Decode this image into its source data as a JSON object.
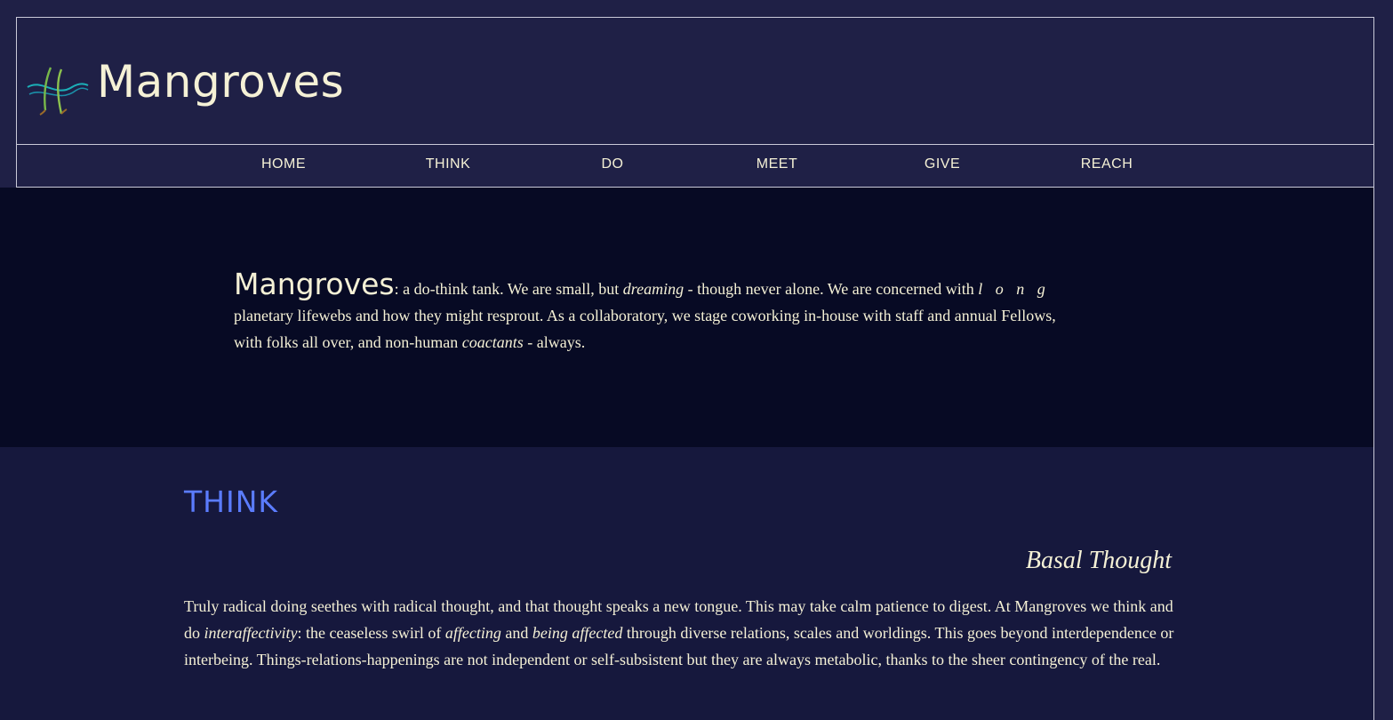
{
  "header": {
    "title": "Mangroves",
    "logo_icon": "mangrove-roots-icon"
  },
  "nav": {
    "items": [
      {
        "label": "HOME"
      },
      {
        "label": "THINK"
      },
      {
        "label": "DO"
      },
      {
        "label": "MEET"
      },
      {
        "label": "GIVE"
      },
      {
        "label": "REACH"
      }
    ]
  },
  "intro": {
    "lead": "Mangroves",
    "p1": ": a do-think tank. We are small, but ",
    "e1": "dreaming",
    "p2": " - though never alone. We are concerned with ",
    "e2": "l o n g",
    "p3": " planetary lifewebs and how they might resprout. As a collaboratory, we stage coworking in-house with staff and annual Fellows, with folks all over, and non-human ",
    "e3": "coactants",
    "p4": " - always."
  },
  "think": {
    "heading": "THINK",
    "subheading": "Basal Thought",
    "t1": "Truly radical doing seethes with radical thought, and that thought speaks a new tongue. This may take calm patience to digest. At Mangroves we think and do ",
    "e1": "interaffectivity",
    "t2": ": the ceaseless swirl of ",
    "e2": "affecting",
    "t3": " and ",
    "e3": "being affected",
    "t4": " through diverse relations, scales and worldings. This goes beyond interdependence or interbeing. Things-relations-happenings are not independent or self-subsistent but they are always metabolic, thanks to the sheer contingency of the real."
  },
  "colors": {
    "background": "#1f2046",
    "intro_band": "#070a24",
    "think_band": "#16183d",
    "text": "#f5f1d6",
    "accent": "#5b7cff"
  }
}
